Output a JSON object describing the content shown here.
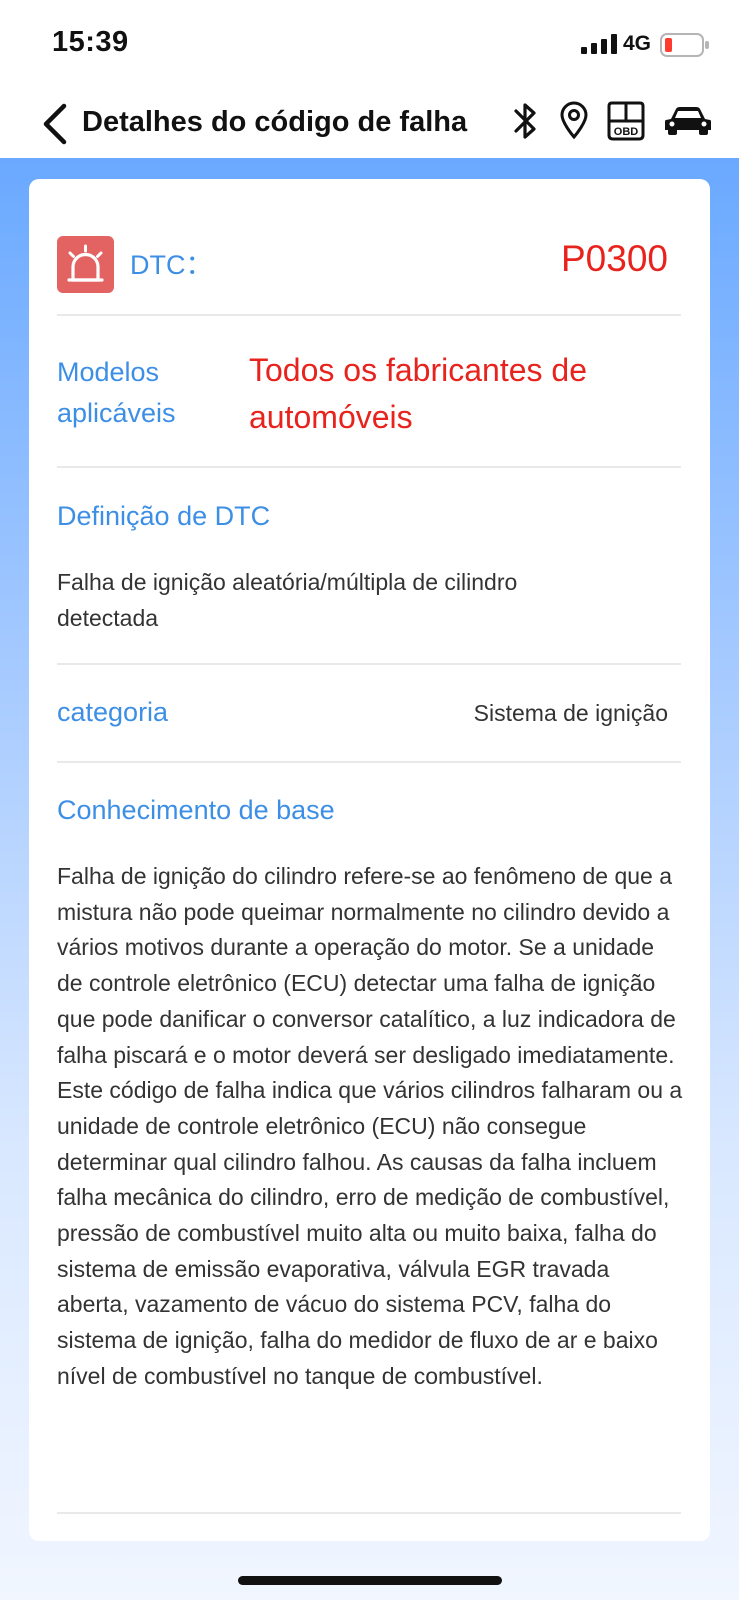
{
  "status_bar": {
    "time": "15:39",
    "network": "4G"
  },
  "nav": {
    "title": "Detalhes do código de falha",
    "icons": [
      "back-icon",
      "bluetooth-icon",
      "location-pin-icon",
      "obd-icon",
      "car-icon"
    ],
    "obd_icon_label": "OBD"
  },
  "dtc": {
    "label": "DTC：",
    "code": "P0300"
  },
  "models": {
    "label": "Modelos aplicáveis",
    "value": "Todos os fabricantes de automóveis"
  },
  "definition": {
    "heading": "Definição de DTC",
    "text": "Falha de ignição aleatória/múltipla de cilindro detectada"
  },
  "category": {
    "label": "categoria",
    "value": "Sistema de ignição"
  },
  "knowledge": {
    "heading": "Conhecimento de base",
    "text": "Falha de ignição do cilindro refere-se ao fenômeno de que a mistura não pode queimar normalmente no cilindro devido a vários motivos durante a operação do motor. Se a unidade de controle eletrônico (ECU) detectar uma falha de ignição que pode danificar o conversor catalítico, a luz indicadora de falha piscará e o motor deverá ser desligado imediatamente. Este código de falha indica que vários cilindros falharam ou a unidade de controle eletrônico (ECU) não consegue determinar qual cilindro falhou. As causas da falha incluem falha mecânica do cilindro, erro de medição de combustível, pressão de combustível muito alta ou muito baixa, falha do sistema de emissão evaporativa, válvula EGR travada aberta, vazamento de vácuo do sistema PCV, falha do sistema de ignição, falha do medidor de fluxo de ar e baixo nível de combustível no tanque de combustível."
  },
  "colors": {
    "accent_blue": "#3d8fe6",
    "highlight_red": "#e8231d",
    "alarm_icon_bg": "#e36363"
  }
}
